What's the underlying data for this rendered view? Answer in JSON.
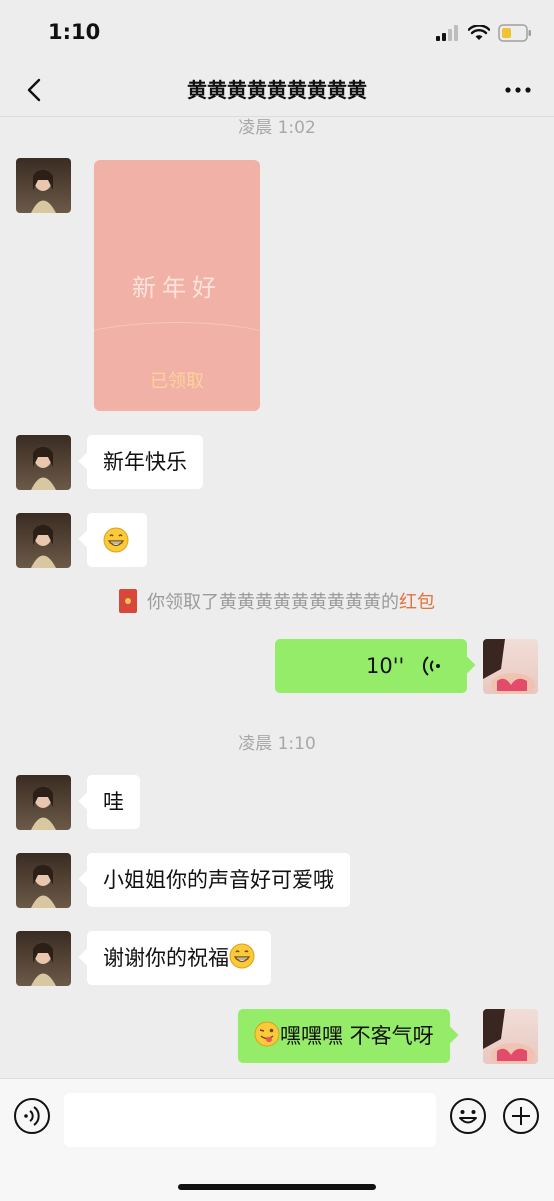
{
  "status": {
    "time": "1:10"
  },
  "nav": {
    "title": "黄黄黄黄黄黄黄黄黄"
  },
  "messages": {
    "timestamp1": "凌晨 1:02",
    "redpacket_greeting": "新年好",
    "redpacket_status": "已领取",
    "m1": "新年快乐",
    "system_prefix": "你领取了黄黄黄黄黄黄黄黄黄的",
    "system_highlight": "红包",
    "voice_duration": "10''",
    "timestamp2": "凌晨 1:10",
    "m2": "哇",
    "m3": "小姐姐你的声音好可爱哦",
    "m4": "谢谢你的祝福",
    "m5": "嘿嘿嘿 不客气呀"
  },
  "icons": {
    "back": "chevron-left-icon",
    "more": "more-dots-icon",
    "voice": "voice-input-icon",
    "emoji": "emoji-icon",
    "add": "plus-icon"
  },
  "colors": {
    "bg": "#ededed",
    "outgoing": "#95ec69",
    "incoming": "#ffffff",
    "redpacket": "#f2b1a6",
    "highlight": "#e4723c"
  }
}
